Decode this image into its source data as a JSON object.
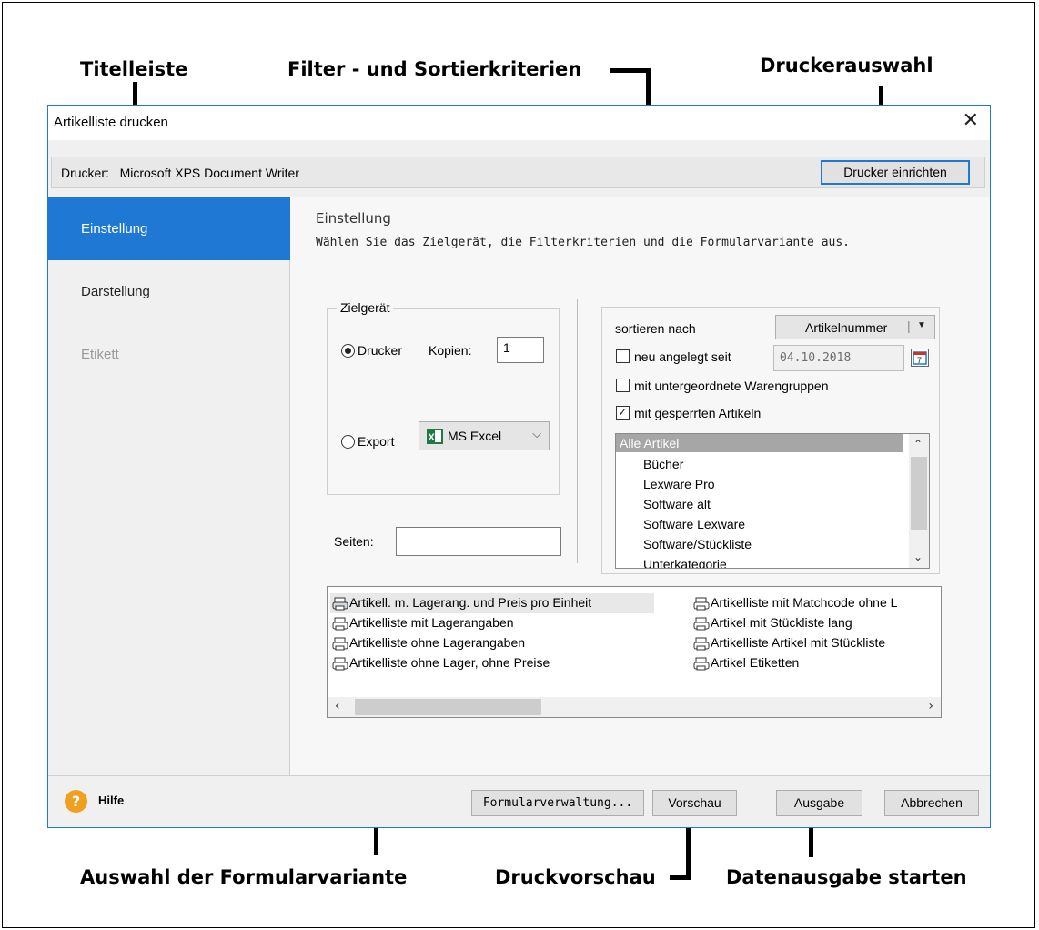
{
  "annotations": {
    "titelleiste": "Titelleiste",
    "filter": "Filter - und Sortierkriterien",
    "druckerauswahl": "Druckerauswahl",
    "formularvariante": "Auswahl der Formularvariante",
    "druckvorschau": "Druckvorschau",
    "datenausgabe": "Datenausgabe starten"
  },
  "window": {
    "title": "Artikelliste drucken",
    "close": "✕"
  },
  "printer": {
    "label": "Drucker:",
    "name": "Microsoft XPS Document Writer",
    "setup_button": "Drucker einrichten"
  },
  "sidebar": {
    "items": [
      {
        "label": "Einstellung"
      },
      {
        "label": "Darstellung"
      },
      {
        "label": "Etikett"
      }
    ]
  },
  "content": {
    "heading": "Einstellung",
    "subheading": "Wählen Sie das Zielgerät, die Filterkriterien und die Formularvariante aus."
  },
  "zielgeraet": {
    "title": "Zielgerät",
    "drucker_label": "Drucker",
    "kopien_label": "Kopien:",
    "kopien_value": "1",
    "export_label": "Export",
    "export_format": "MS Excel",
    "selected": "Drucker"
  },
  "seiten": {
    "label": "Seiten:",
    "value": ""
  },
  "filter": {
    "sort_label": "sortieren nach",
    "sort_value": "Artikelnummer",
    "neu_label": "neu angelegt seit",
    "neu_checked": false,
    "date_value": "04.10.2018",
    "untergeordnete_label": "mit untergeordnete Warengruppen",
    "untergeordnete_checked": false,
    "gesperrt_label": "mit gesperrten Artikeln",
    "gesperrt_checked": true,
    "groups_selected": "Alle Artikel",
    "groups": [
      "Bücher",
      "Lexware Pro",
      "Software alt",
      "Software Lexware",
      "Software/Stückliste",
      "Unterkategorie"
    ]
  },
  "forms": {
    "left": [
      "Artikell. m. Lagerang. und Preis pro Einheit",
      "Artikelliste mit Lagerangaben",
      "Artikelliste ohne Lagerangaben",
      "Artikelliste ohne Lager, ohne Preise"
    ],
    "right": [
      "Artikelliste mit Matchcode ohne L",
      "Artikel mit Stückliste lang",
      "Artikelliste Artikel mit Stückliste",
      "Artikel Etiketten"
    ]
  },
  "footer": {
    "help_icon": "?",
    "help_label": "Hilfe",
    "formularverwaltung": "Formularverwaltung...",
    "vorschau": "Vorschau",
    "ausgabe": "Ausgabe",
    "abbrechen": "Abbrechen"
  },
  "colors": {
    "accent": "#1e78d4",
    "excel": "#1d7a45",
    "help": "#f0a020"
  }
}
